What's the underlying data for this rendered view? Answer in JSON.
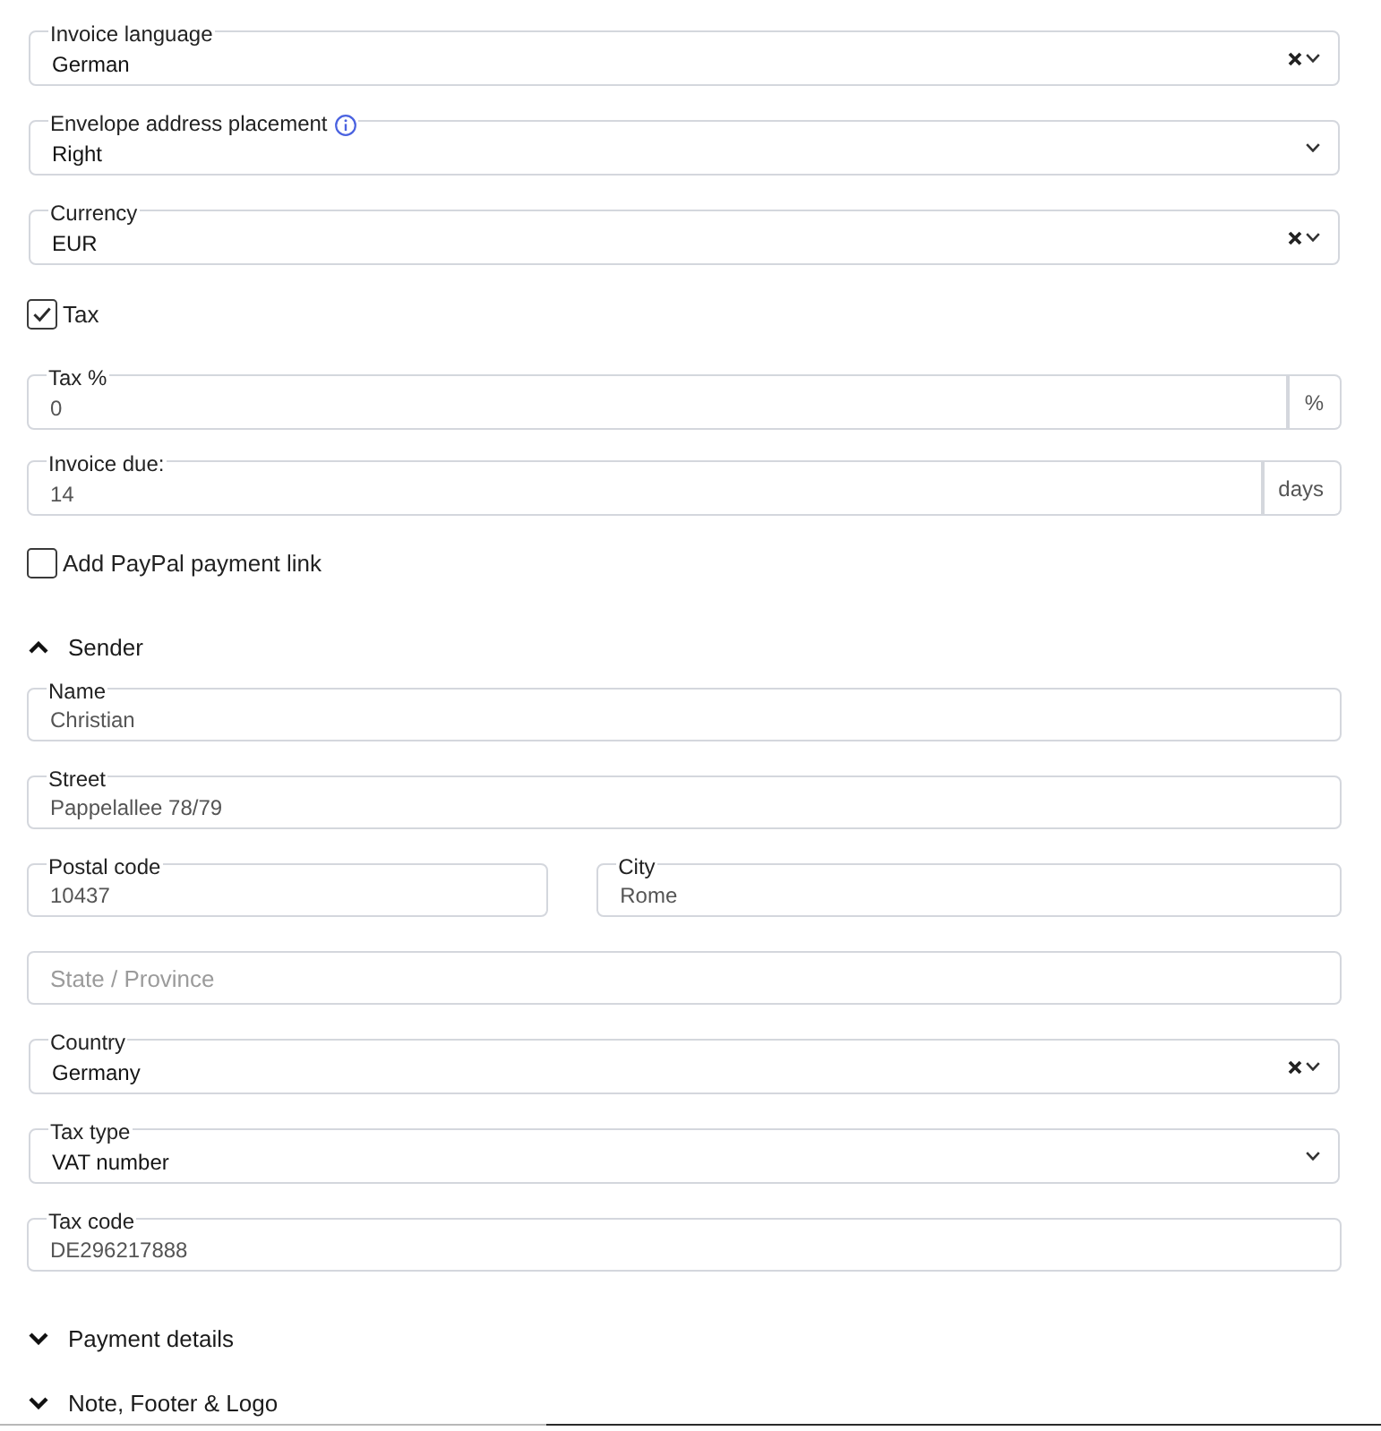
{
  "fields": [
    {
      "kind": "select",
      "label": "Invoice language",
      "value": "German",
      "clearable": true
    },
    {
      "kind": "select",
      "label": "Envelope address placement",
      "info": true,
      "value": "Right",
      "clearable": false
    },
    {
      "kind": "select",
      "label": "Currency",
      "value": "EUR",
      "clearable": true
    },
    {
      "kind": "checkbox",
      "label": "Tax",
      "checked": true
    },
    {
      "kind": "unit_input",
      "label": "Tax %",
      "value": "0",
      "unit": "%"
    },
    {
      "kind": "unit_input",
      "label": "Invoice due:",
      "value": "14",
      "unit": "days"
    },
    {
      "kind": "checkbox",
      "label": "Add PayPal payment link",
      "checked": false
    }
  ],
  "sections": [
    {
      "title": "Sender",
      "expanded": true,
      "rows": [
        {
          "fields": [
            {
              "kind": "input",
              "label": "Name",
              "value": "Christian"
            }
          ]
        },
        {
          "fields": [
            {
              "kind": "input",
              "label": "Street",
              "value": "Pappelallee 78/79"
            }
          ]
        },
        {
          "fields": [
            {
              "kind": "input",
              "label": "Postal code",
              "value": "10437"
            },
            {
              "kind": "input",
              "label": "City",
              "value": "Rome"
            }
          ]
        },
        {
          "fields": [
            {
              "kind": "input",
              "placeholder": "State / Province"
            }
          ]
        },
        {
          "fields": [
            {
              "kind": "select",
              "label": "Country",
              "value": "Germany",
              "clearable": true
            }
          ]
        },
        {
          "fields": [
            {
              "kind": "select",
              "label": "Tax type",
              "value": "VAT number",
              "clearable": false
            }
          ]
        },
        {
          "fields": [
            {
              "kind": "input",
              "label": "Tax code",
              "value": "DE296217888"
            }
          ]
        }
      ]
    },
    {
      "title": "Payment details",
      "expanded": false
    },
    {
      "title": "Note, Footer & Logo",
      "expanded": false
    }
  ]
}
